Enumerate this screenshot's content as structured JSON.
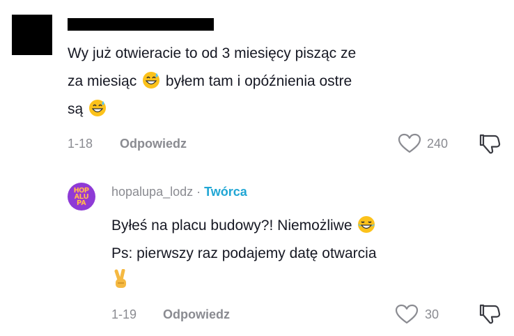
{
  "comment": {
    "text_line1": "Wy już otwieracie to od 3 miesięcy pisząc ze",
    "text_line2_a": "za miesiąc",
    "text_line2_b": "byłem tam i opóźnienia ostre",
    "text_line3": "są",
    "date": "1-18",
    "reply_label": "Odpowiedz",
    "likes": "240"
  },
  "reply": {
    "username": "hopalupa_lodz",
    "separator": "·",
    "badge": "Twórca",
    "avatar_text": "HOPALUPA",
    "text_line1": "Byłeś na placu budowy?! Niemożliwe",
    "text_line2": "Ps: pierwszy raz podajemy datę otwarcia",
    "date": "1-19",
    "reply_label": "Odpowiedz",
    "likes": "30"
  },
  "colors": {
    "text": "#161823",
    "muted": "#8a8b91",
    "creator_badge": "#20a6d4",
    "avatar_bg": "#8e3bd6"
  },
  "icons": [
    "heart-icon",
    "dislike-icon",
    "grinning-sweat-emoji",
    "tears-of-joy-emoji",
    "victory-hand-emoji"
  ]
}
